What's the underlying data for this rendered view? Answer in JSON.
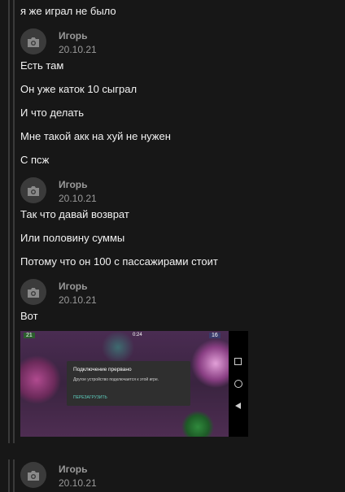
{
  "messages": {
    "top_text": "я же играл не было",
    "groups": [
      {
        "author": "Игорь",
        "date": "20.10.21",
        "lines": [
          "Есть там",
          "Он уже каток 10 сыграл",
          "И что делать",
          "Мне такой акк на хуй не нужен",
          "С псж"
        ]
      },
      {
        "author": "Игорь",
        "date": "20.10.21",
        "lines": [
          "Так что давай возврат",
          "Или половину суммы",
          "Потому что он 100 с пассажирами стоит"
        ]
      },
      {
        "author": "Игорь",
        "date": "20.10.21",
        "lines": [
          "Вот"
        ],
        "attachment": {
          "hud_left": "21",
          "hud_mid": "0:24",
          "hud_right": "16",
          "dialog_title": "Подключение прервано",
          "dialog_body": "Другое устройство подключается к этой игре.",
          "dialog_button": "ПЕРЕЗАГРУЗИТЬ"
        }
      },
      {
        "author": "Игорь",
        "date": "20.10.21",
        "lines": []
      }
    ]
  },
  "icons": {
    "avatar": "camera-icon"
  },
  "colors": {
    "background": "#171717",
    "meta_text": "#9a9a9a",
    "avatar_bg": "#3b3b3b",
    "thread_line": "#3a3a3a"
  }
}
